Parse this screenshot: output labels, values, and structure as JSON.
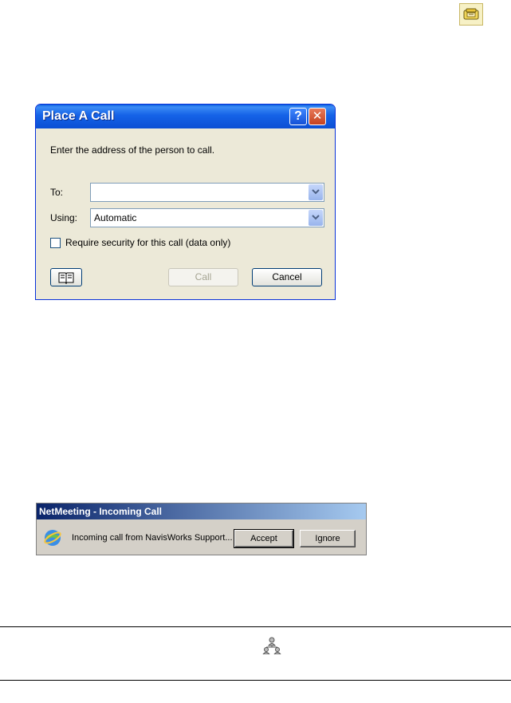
{
  "top_icon": {
    "name": "place-call-icon"
  },
  "place_call_dialog": {
    "title": "Place A Call",
    "help_button": "?",
    "close_button": "✕",
    "instruction": "Enter the address of the person to call.",
    "to_label": "To:",
    "to_value": "",
    "using_label": "Using:",
    "using_value": "Automatic",
    "security_checkbox_label": "Require security for this call (data only)",
    "security_checked": false,
    "address_book_icon": "address-book-icon",
    "call_button": "Call",
    "cancel_button": "Cancel"
  },
  "incoming_call": {
    "title": "NetMeeting - Incoming Call",
    "icon": "netmeeting-icon",
    "message": "Incoming call from NavisWorks Support...",
    "accept_button": "Accept",
    "ignore_button": "Ignore"
  },
  "footer": {
    "icon": "network-users-icon"
  }
}
